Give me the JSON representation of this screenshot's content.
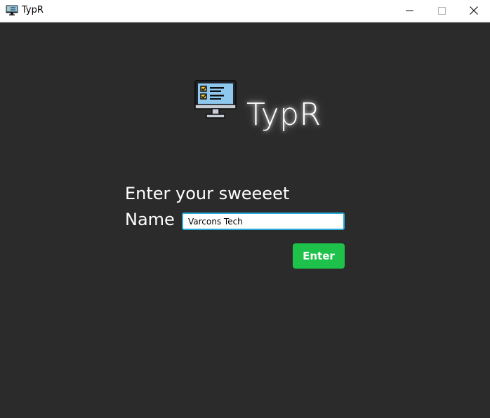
{
  "window": {
    "title": "TypR",
    "icon": "computer-checklist-icon",
    "controls": [
      "minimize-icon",
      "maximize-icon",
      "close-icon"
    ]
  },
  "brand": {
    "logo_icon": "computer-checklist-icon",
    "name": "TypR"
  },
  "form": {
    "prompt_line1": "Enter your sweeeet",
    "prompt_line2": "Name",
    "name_value": "Varcons Tech",
    "enter_label": "Enter"
  },
  "colors": {
    "background": "#2b2b2b",
    "accent_green": "#1ec24b",
    "input_border": "#2aa8d8",
    "text": "#ffffff"
  }
}
